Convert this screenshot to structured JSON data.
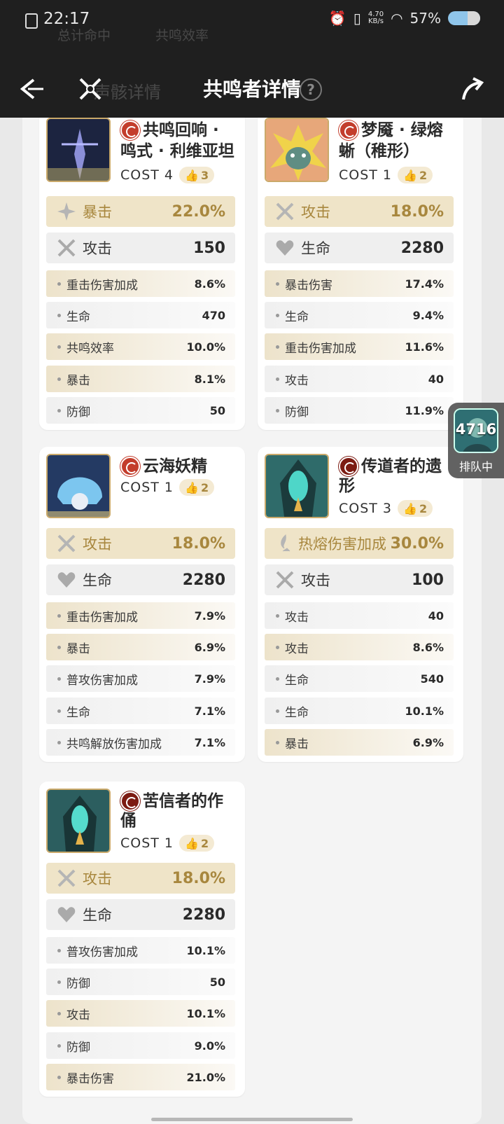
{
  "status": {
    "time": "22:17",
    "net_speed": "4.70\nKB/s",
    "battery": "57%"
  },
  "ghost_text": {
    "top_left": "总计命中",
    "top_right": "共鸣效率",
    "under_title": "声骸详情"
  },
  "nav": {
    "title": "共鸣者详情",
    "help": "?"
  },
  "queue": {
    "count": "4716",
    "label": "排队中"
  },
  "cards": [
    {
      "name": "共鸣回响 · 鸣式 · 利维亚坦",
      "name_line1": "共鸣回响 ·",
      "name_line2": "鸣式 · 利维亚坦",
      "cost": "COST 4",
      "likes": "3",
      "main": {
        "label": "暴击",
        "value": "22.0%",
        "icon": "crit-icon"
      },
      "flat": {
        "label": "攻击",
        "value": "150",
        "icon": "attack-icon"
      },
      "subs": [
        {
          "label": "重击伤害加成",
          "value": "8.6%",
          "tone": "gold"
        },
        {
          "label": "生命",
          "value": "470",
          "tone": "grey"
        },
        {
          "label": "共鸣效率",
          "value": "10.0%",
          "tone": "gold"
        },
        {
          "label": "暴击",
          "value": "8.1%",
          "tone": "gold"
        },
        {
          "label": "防御",
          "value": "50",
          "tone": "grey"
        }
      ]
    },
    {
      "name": "梦魇 · 绿熔蜥（稚形）",
      "name_line1": "梦魇 · 绿熔",
      "name_line2": "蜥（稚形）",
      "cost": "COST 1",
      "likes": "2",
      "main": {
        "label": "攻击",
        "value": "18.0%",
        "icon": "attack-icon"
      },
      "flat": {
        "label": "生命",
        "value": "2280",
        "icon": "heart-icon"
      },
      "subs": [
        {
          "label": "暴击伤害",
          "value": "17.4%",
          "tone": "gold"
        },
        {
          "label": "生命",
          "value": "9.4%",
          "tone": "grey"
        },
        {
          "label": "重击伤害加成",
          "value": "11.6%",
          "tone": "gold"
        },
        {
          "label": "攻击",
          "value": "40",
          "tone": "grey"
        },
        {
          "label": "防御",
          "value": "11.9%",
          "tone": "grey"
        }
      ]
    },
    {
      "name": "云海妖精",
      "name_line1": "云海妖精",
      "name_line2": "",
      "cost": "COST 1",
      "likes": "2",
      "main": {
        "label": "攻击",
        "value": "18.0%",
        "icon": "attack-icon"
      },
      "flat": {
        "label": "生命",
        "value": "2280",
        "icon": "heart-icon"
      },
      "subs": [
        {
          "label": "重击伤害加成",
          "value": "7.9%",
          "tone": "gold"
        },
        {
          "label": "暴击",
          "value": "6.9%",
          "tone": "gold"
        },
        {
          "label": "普攻伤害加成",
          "value": "7.9%",
          "tone": "grey"
        },
        {
          "label": "生命",
          "value": "7.1%",
          "tone": "grey"
        },
        {
          "label": "共鸣解放伤害加成",
          "value": "7.1%",
          "tone": "grey"
        }
      ]
    },
    {
      "name": "传道者的遗形",
      "name_line1": "传道者的遗",
      "name_line2": "形",
      "cost": "COST 3",
      "likes": "2",
      "main": {
        "label": "热熔伤害加成",
        "value": "30.0%",
        "icon": "fusion-icon"
      },
      "flat": {
        "label": "攻击",
        "value": "100",
        "icon": "attack-icon"
      },
      "subs": [
        {
          "label": "攻击",
          "value": "40",
          "tone": "grey"
        },
        {
          "label": "攻击",
          "value": "8.6%",
          "tone": "gold"
        },
        {
          "label": "生命",
          "value": "540",
          "tone": "grey"
        },
        {
          "label": "生命",
          "value": "10.1%",
          "tone": "grey"
        },
        {
          "label": "暴击",
          "value": "6.9%",
          "tone": "gold"
        }
      ]
    },
    {
      "name": "苦信者的作俑",
      "name_line1": "苦信者的作",
      "name_line2": "俑",
      "cost": "COST 1",
      "likes": "2",
      "main": {
        "label": "攻击",
        "value": "18.0%",
        "icon": "attack-icon"
      },
      "flat": {
        "label": "生命",
        "value": "2280",
        "icon": "heart-icon"
      },
      "subs": [
        {
          "label": "普攻伤害加成",
          "value": "10.1%",
          "tone": "grey"
        },
        {
          "label": "防御",
          "value": "50",
          "tone": "grey"
        },
        {
          "label": "攻击",
          "value": "10.1%",
          "tone": "gold"
        },
        {
          "label": "防御",
          "value": "9.0%",
          "tone": "grey"
        },
        {
          "label": "暴击伤害",
          "value": "21.0%",
          "tone": "gold"
        }
      ]
    }
  ]
}
